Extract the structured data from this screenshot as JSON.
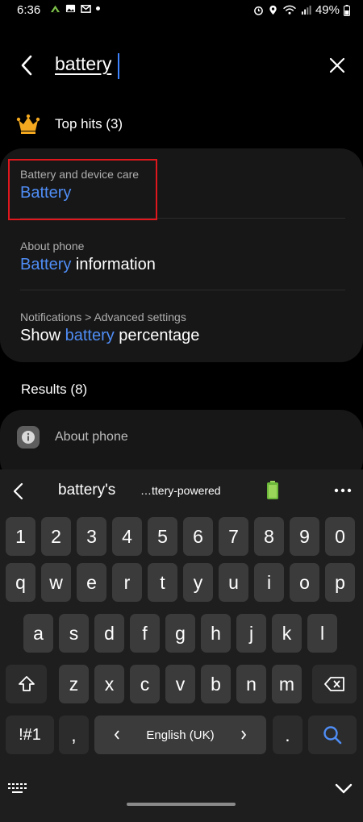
{
  "status_bar": {
    "time": "6:36",
    "battery_percent": "49%"
  },
  "search": {
    "query": "battery"
  },
  "top_hits": {
    "label": "Top hits (3)",
    "items": [
      {
        "subtitle": "Battery and device care",
        "title_highlight": "Battery",
        "title_rest": ""
      },
      {
        "subtitle": "About phone",
        "title_highlight": "Battery",
        "title_rest": " information"
      },
      {
        "subtitle": "Notifications > Advanced settings",
        "title_prefix": "Show ",
        "title_highlight": "battery",
        "title_rest": " percentage"
      }
    ]
  },
  "results": {
    "label": "Results (8)",
    "items": [
      {
        "label": "About phone"
      }
    ]
  },
  "keyboard": {
    "suggestions": [
      "battery's",
      "…ttery-powered"
    ],
    "row_numbers": [
      "1",
      "2",
      "3",
      "4",
      "5",
      "6",
      "7",
      "8",
      "9",
      "0"
    ],
    "row1": [
      "q",
      "w",
      "e",
      "r",
      "t",
      "y",
      "u",
      "i",
      "o",
      "p"
    ],
    "row2": [
      "a",
      "s",
      "d",
      "f",
      "g",
      "h",
      "j",
      "k",
      "l"
    ],
    "row3": [
      "z",
      "x",
      "c",
      "v",
      "b",
      "n",
      "m"
    ],
    "symbols_key": "!#1",
    "comma_key": ",",
    "space_label": "English (UK)",
    "period_key": ".",
    "colors": {
      "key": "#3b3b3b",
      "accent": "#4f8df5"
    }
  }
}
